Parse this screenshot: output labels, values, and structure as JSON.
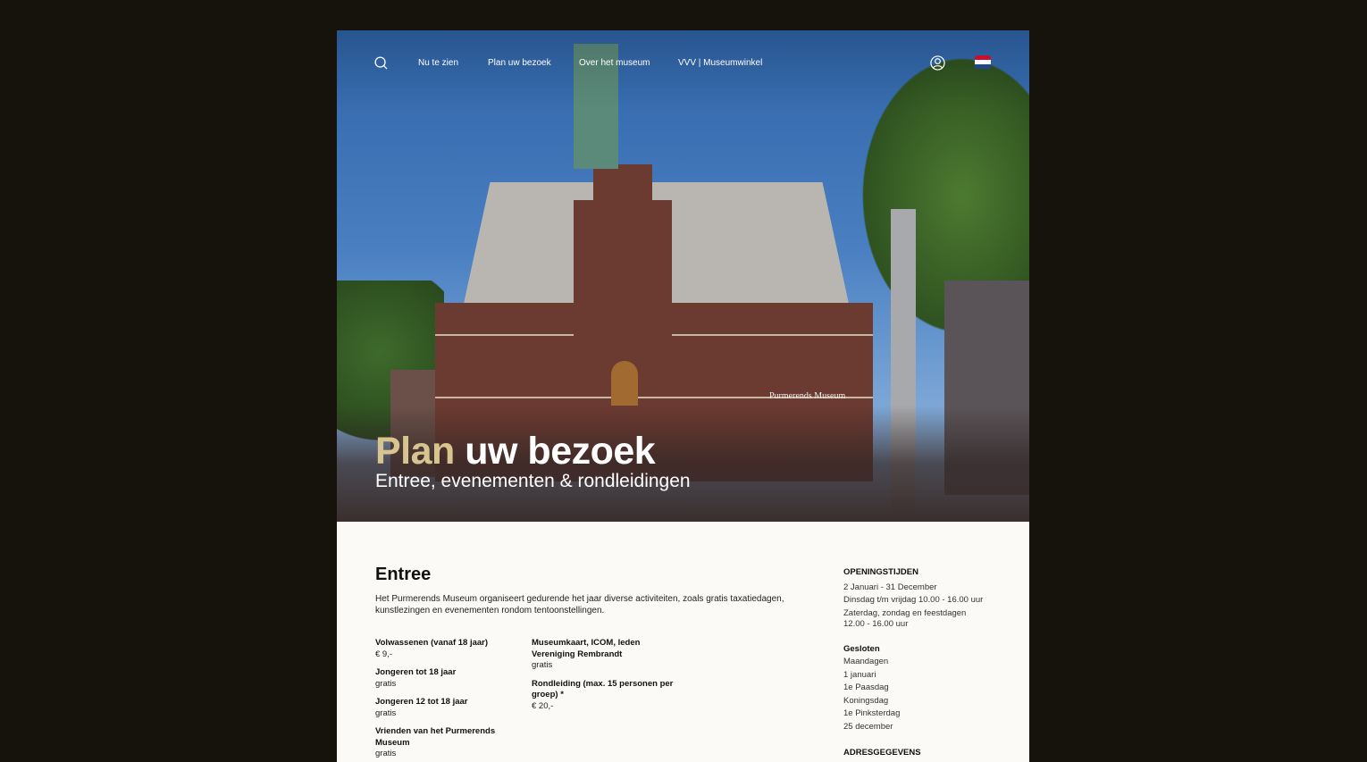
{
  "nav": {
    "items": [
      "Nu te zien",
      "Plan uw bezoek",
      "Over het museum",
      "VVV | Museumwinkel"
    ],
    "search_icon": "search-icon",
    "account_icon": "user-icon",
    "language_flag": "dutch-flag-icon"
  },
  "hero": {
    "title_accent": "Plan",
    "title_rest": "uw bezoek",
    "subtitle": "Entree, evenementen & rondleidingen",
    "building_sign": "Purmerends Museum",
    "accent_color": "#d8c48e"
  },
  "entree": {
    "title": "Entree",
    "intro": "Het Purmerends Museum organiseert gedurende het jaar diverse activiteiten, zoals gratis taxatiedagen, kunstlezingen en evenementen rondom tentoonstellingen.",
    "prices_left": [
      {
        "label": "Volwassenen (vanaf 18 jaar)",
        "value": "€ 9,-"
      },
      {
        "label": "Jongeren tot 18 jaar",
        "value": "gratis"
      },
      {
        "label": "Jongeren 12 tot 18 jaar",
        "value": "gratis"
      },
      {
        "label": "Vrienden van het Purmerends Museum",
        "value": "gratis"
      }
    ],
    "prices_right": [
      {
        "label": "Museumkaart, ICOM, leden Vereniging Rembrandt",
        "value": "gratis"
      },
      {
        "label": "Rondleiding (max. 15 personen per groep) *",
        "value": "€ 20,-"
      }
    ]
  },
  "sidebar": {
    "opening_title": "OPENINGSTIJDEN",
    "opening_lines": [
      "2 Januari - 31 December",
      "Dinsdag t/m vrijdag 10.00 - 16.00 uur",
      "Zaterdag, zondag en feestdagen 12.00 - 16.00 uur"
    ],
    "closed_title": "Gesloten",
    "closed_lines": [
      "Maandagen",
      "1 januari",
      "1e Paasdag",
      "Koningsdag",
      "1e Pinksterdag",
      "25 december"
    ],
    "address_title": "ADRESGEGEVENS"
  }
}
